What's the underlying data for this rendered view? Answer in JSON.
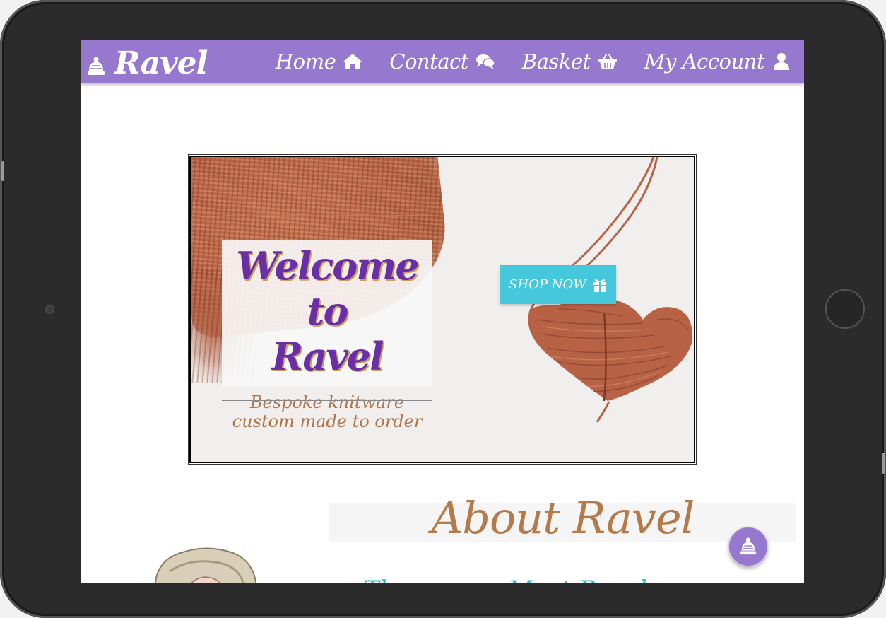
{
  "brand": {
    "name": "Ravel",
    "icon": "beanie-hat-icon"
  },
  "nav": {
    "items": [
      {
        "label": "Home",
        "icon": "home-icon"
      },
      {
        "label": "Contact",
        "icon": "comments-icon"
      },
      {
        "label": "Basket",
        "icon": "shopping-basket-icon"
      },
      {
        "label": "My Account",
        "icon": "user-icon"
      }
    ]
  },
  "hero": {
    "title_line1": "Welcome to",
    "title_line2": "Ravel",
    "subtitle": "Bespoke knitware custom made to order",
    "cta_label": "SHOP NOW",
    "cta_icon": "gift-icon"
  },
  "about": {
    "title": "About Ravel",
    "intro_partial": "The ... ... ... Meet Ravel ..."
  },
  "fab": {
    "icon": "beanie-hat-icon"
  },
  "colors": {
    "navbar": "#9678cf",
    "hero_title": "#6a2fa5",
    "accent_brown": "#b57a4a",
    "cta": "#46c8dc",
    "teal_text": "#3ab6c8"
  }
}
